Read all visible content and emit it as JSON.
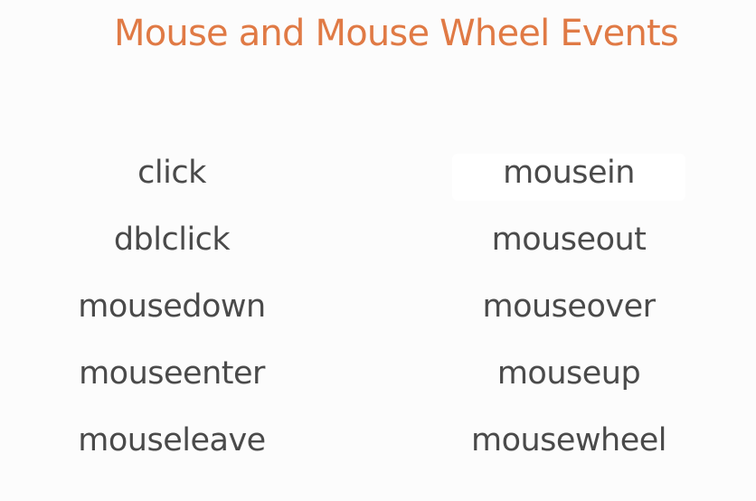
{
  "slide": {
    "title": "Mouse and Mouse Wheel Events",
    "left_events": [
      "click",
      "dblclick",
      "mousedown",
      "mouseenter",
      "mouseleave"
    ],
    "right_events": [
      "mousein",
      "mouseout",
      "mouseover",
      "mouseup",
      "mousewheel"
    ]
  },
  "colors": {
    "title": "#e07a45",
    "text": "#4a4a4a",
    "background": "#fcfcfc"
  }
}
